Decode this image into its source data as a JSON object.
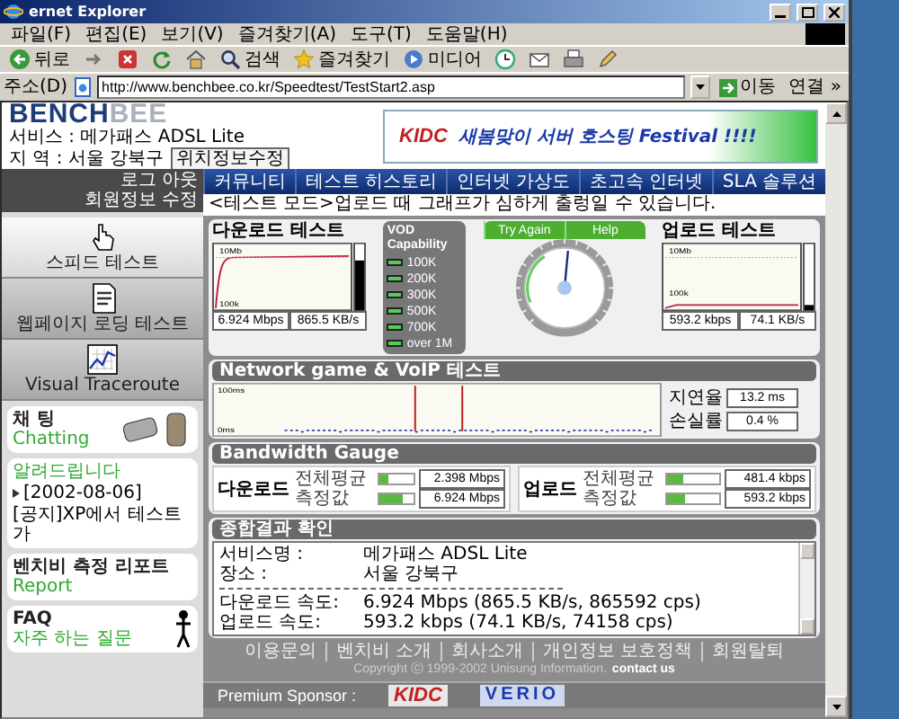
{
  "window": {
    "title": "ernet Explorer"
  },
  "menu": [
    "파일(F)",
    "편집(E)",
    "보기(V)",
    "즐겨찾기(A)",
    "도구(T)",
    "도움말(H)"
  ],
  "toolbar": [
    {
      "kind": "back",
      "label": "뒤로"
    },
    {
      "kind": "forward"
    },
    {
      "kind": "stop"
    },
    {
      "kind": "refresh"
    },
    {
      "kind": "home"
    },
    {
      "kind": "search",
      "label": "검색"
    },
    {
      "kind": "favorites",
      "label": "즐겨찾기"
    },
    {
      "kind": "media",
      "label": "미디어"
    },
    {
      "kind": "history"
    },
    {
      "kind": "mail"
    },
    {
      "kind": "print"
    },
    {
      "kind": "edit"
    }
  ],
  "address_bar": {
    "label": "주소(D)",
    "url": "http://www.benchbee.co.kr/Speedtest/TestStart2.asp",
    "go": "이동",
    "links": "연결 »"
  },
  "header": {
    "logo": [
      "BENCH",
      "BEE"
    ],
    "service": "서비스 : 메가패스 ADSL Lite",
    "region": "지 역 : 서울 강북구",
    "edit_button": "위치정보수정",
    "banner": {
      "brand": "KIDC",
      "text": "새봄맞이 서버 호스팅 Festival !!!!"
    }
  },
  "account_links": [
    "로그 아웃",
    "회원정보 수정"
  ],
  "nav": [
    "커뮤니티",
    "테스트 히스토리",
    "인터넷 가상도",
    "초고속 인터넷",
    "SLA 솔루션"
  ],
  "sidebar": {
    "items": [
      {
        "kind": "speed",
        "label": "스피드 테스트",
        "selected": true
      },
      {
        "kind": "webpage",
        "label": "웹페이지 로딩 테스트",
        "selected": false
      },
      {
        "kind": "trace",
        "label": "Visual Traceroute",
        "selected": false
      }
    ],
    "chat": {
      "title": "채 팅",
      "subtitle": "Chatting"
    },
    "notice": {
      "title": "알려드립니다",
      "date": "[2002-08-06]",
      "text": "[공지]XP에서 테스트가"
    },
    "report": {
      "title": "벤치비 측정 리포트",
      "subtitle": "Report"
    },
    "faq": {
      "title": "FAQ",
      "subtitle": "자주 하는 질문"
    }
  },
  "notice_line": "<테스트 모드>업로드 때 그래프가 심하게 출렁일 수 있습니다.",
  "download_test": {
    "title": "다운로드 테스트",
    "top": "10Mb",
    "bottom": "100k",
    "speed": "6.924 Mbps",
    "rate": "865.5 KB/s"
  },
  "vod": {
    "title": "VOD Capability",
    "levels": [
      {
        "label": "100K",
        "on": true
      },
      {
        "label": "200K",
        "on": true
      },
      {
        "label": "300K",
        "on": true
      },
      {
        "label": "500K",
        "on": true
      },
      {
        "label": "700K",
        "on": true
      },
      {
        "label": "over 1M",
        "on": true
      }
    ]
  },
  "gauge": {
    "buttons": [
      "Try Again",
      "Help"
    ],
    "level": 0.52
  },
  "upload_test": {
    "title": "업로드 테스트",
    "top": "10Mb",
    "bottom": "100k",
    "speed": "593.2 kbps",
    "rate": "74.1 KB/s"
  },
  "network_test": {
    "title": "Network game & VoIP 테스트",
    "top": "100ms",
    "bottom": "0ms",
    "delay_label": "지연율",
    "delay": "13.2 ms",
    "loss_label": "손실률",
    "loss": "0.4 %"
  },
  "bandwidth": {
    "title": "Bandwidth Gauge",
    "groups": [
      {
        "title": "다운로드",
        "rows": [
          {
            "label": "전체평균",
            "level": 0.24,
            "value": "2.398 Mbps"
          },
          {
            "label": "측정값",
            "level": 0.66,
            "value": "6.924 Mbps"
          }
        ]
      },
      {
        "title": "업로드",
        "rows": [
          {
            "label": "전체평균",
            "level": 0.3,
            "value": "481.4 kbps"
          },
          {
            "label": "측정값",
            "level": 0.35,
            "value": "593.2 kbps"
          }
        ]
      }
    ]
  },
  "result": {
    "title": "종합결과 확인",
    "lines": [
      {
        "kind": "pair",
        "key": "서비스명 :",
        "value": "메가패스 ADSL Lite"
      },
      {
        "kind": "pair",
        "key": "장소 :",
        "value": "서울 강북구"
      },
      {
        "kind": "rule"
      },
      {
        "kind": "pair",
        "key": "다운로드 속도:",
        "value": "6.924 Mbps (865.5 KB/s, 865592 cps)"
      },
      {
        "kind": "pair",
        "key": "업로드 속도:",
        "value": "593.2 kbps (74.1 KB/s, 74158 cps)"
      }
    ]
  },
  "footer": {
    "links": [
      "이용문의",
      "벤치비 소개",
      "회사소개",
      "개인정보 보호정책",
      "회원탈퇴"
    ],
    "copyright": "Copyright ⓒ 1999-2002 Unisung Information.",
    "contact": "contact us",
    "sponsor_label": "Premium Sponsor :",
    "sponsors": [
      {
        "kind": "kidc",
        "name": "KIDC"
      },
      {
        "kind": "verio",
        "name": "VERIO"
      }
    ]
  }
}
